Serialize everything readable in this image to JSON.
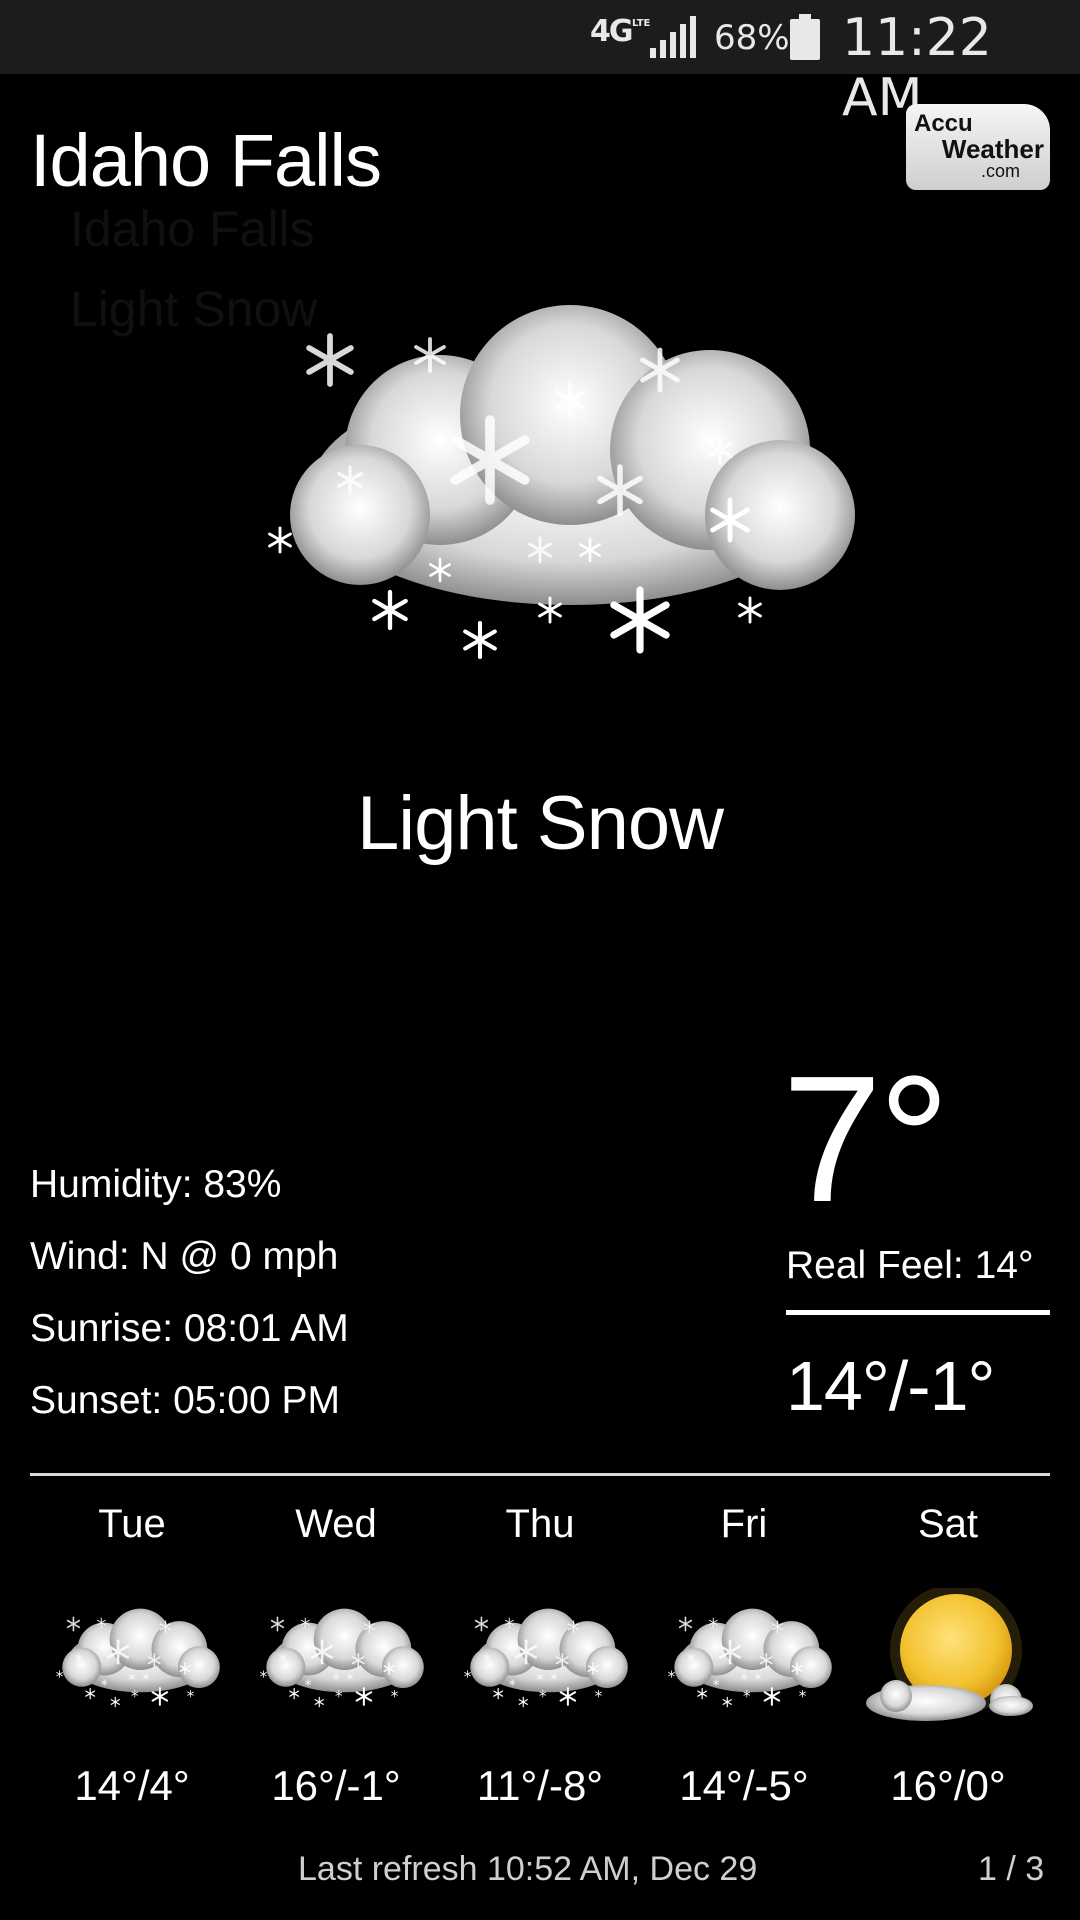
{
  "status_bar": {
    "network": "4G",
    "network_sub": "LTE",
    "battery": "68%",
    "time": "11:22 AM"
  },
  "logo": {
    "line1": "Accu",
    "line2": "Weather",
    "line3": ".com"
  },
  "location": "Idaho Falls",
  "condition": "Light Snow",
  "condition_icon": "snow-cloud-icon",
  "details": {
    "humidity": "Humidity: 83%",
    "wind": "Wind: N @ 0 mph",
    "sunrise": "Sunrise: 08:01 AM",
    "sunset": "Sunset: 05:00 PM"
  },
  "current": {
    "temp": "7°",
    "real_feel": "Real Feel: 14°",
    "hi_lo": "14°/-1°"
  },
  "forecast": [
    {
      "day": "Tue",
      "range": "14°/4°",
      "icon": "snow-cloud-icon"
    },
    {
      "day": "Wed",
      "range": "16°/-1°",
      "icon": "snow-cloud-icon"
    },
    {
      "day": "Thu",
      "range": "11°/-8°",
      "icon": "snow-cloud-icon"
    },
    {
      "day": "Fri",
      "range": "14°/-5°",
      "icon": "snow-cloud-icon"
    },
    {
      "day": "Sat",
      "range": "16°/0°",
      "icon": "sun-cloud-icon"
    }
  ],
  "footer": {
    "last_refresh": "Last refresh 10:52 AM, Dec 29",
    "page": "1 / 3"
  },
  "colors": {
    "background": "#000000",
    "text": "#ffffff",
    "sun": "#f2c12e"
  }
}
